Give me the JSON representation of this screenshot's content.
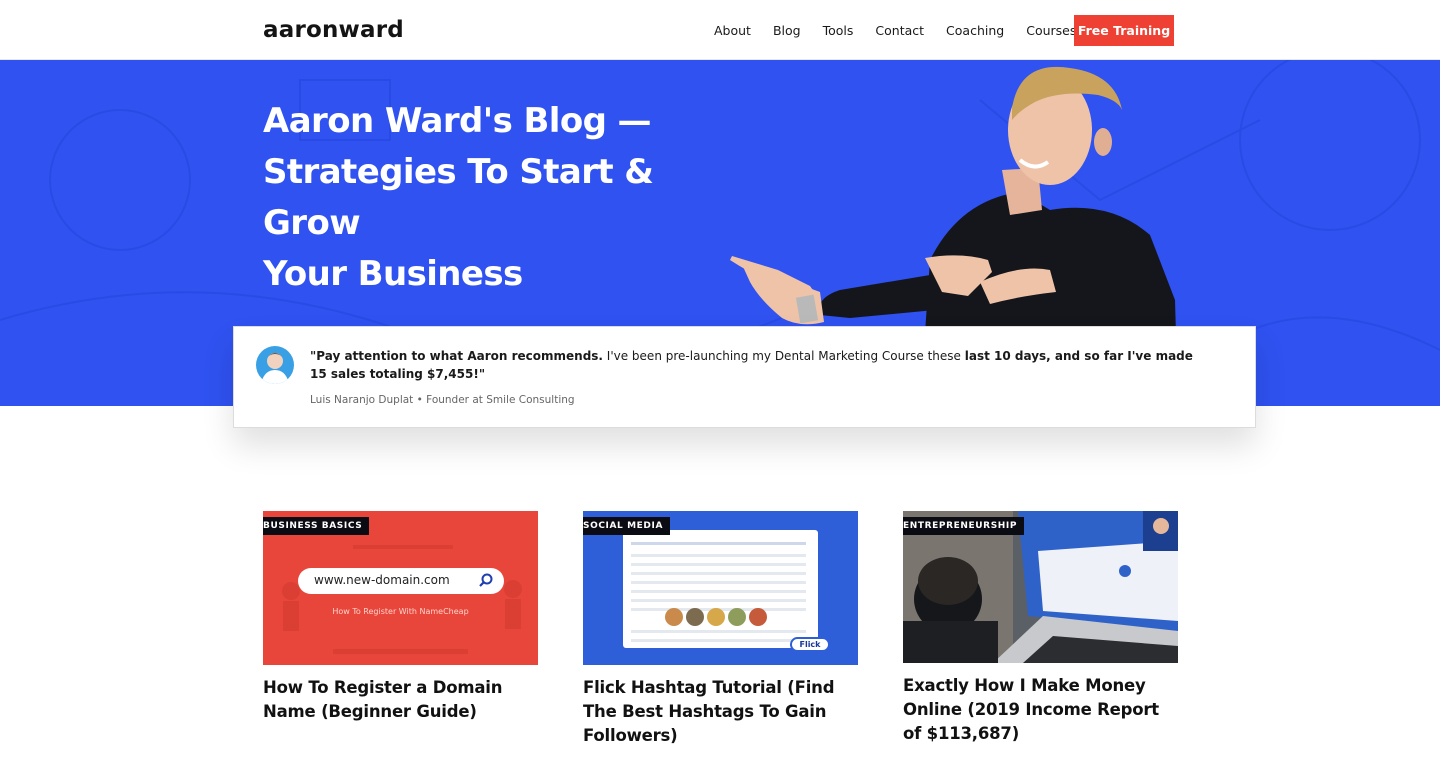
{
  "header": {
    "logo": "aaronward",
    "nav": [
      "About",
      "Blog",
      "Tools",
      "Contact",
      "Coaching",
      "Courses"
    ],
    "cta": "Free Training"
  },
  "hero": {
    "title_line1": "Aaron Ward's Blog —",
    "title_line2": "Strategies To Start & Grow",
    "title_line3": "Your Business"
  },
  "testimonial": {
    "quote_bold1": "\"Pay attention to what Aaron recommends.",
    "quote_plain": " I've been pre-launching my Dental Marketing Course these ",
    "quote_bold2": "last 10 days, and so far I've made 15 sales totaling $7,455!\"",
    "author": "Luis Naranjo Duplat • Founder at Smile Consulting"
  },
  "cards": [
    {
      "tag": "BUSINESS BASICS",
      "title": "How To Register a Domain Name (Beginner Guide)",
      "thumb_search": "www.new-domain.com",
      "thumb_caption": "How To Register With NameCheap"
    },
    {
      "tag": "SOCIAL MEDIA",
      "title": "Flick Hashtag Tutorial (Find The Best Hashtags To Gain Followers)",
      "thumb_badge": "Flick"
    },
    {
      "tag": "ENTREPRENEURSHIP",
      "title": "Exactly How I Make Money Online (2019 Income Report of $113,687)"
    }
  ],
  "colors": {
    "hero_blue": "#2f52f0",
    "cta_red": "#ee4033",
    "tag_dark": "#0b0b14"
  }
}
